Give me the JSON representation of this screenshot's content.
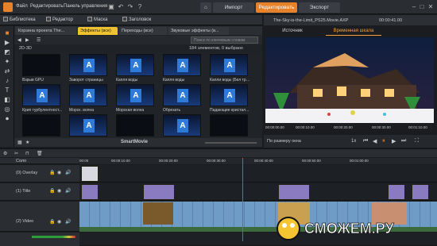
{
  "menu": {
    "items": [
      "Файл",
      "Редактировать",
      "Панель управления"
    ],
    "tabs": [
      "Импорт",
      "Редактировать",
      "Экспорт"
    ],
    "active_tab": "Редактировать"
  },
  "library_toolbar": {
    "library": "Библиотека",
    "editor": "Редактор",
    "mask": "Маска",
    "title": "Заголовок"
  },
  "project_title": "The-Sky-is-the-Limit_PS25.Movie.AXP",
  "timecode_top": "00:00:41.00",
  "lib_tabs": [
    "Корзина проекта The...",
    "Эффекты (все)",
    "Переходы (все)",
    "Звуковые эффекты (в..."
  ],
  "lib_active": "Эффекты (все)",
  "search_placeholder": "Поиск по ключевым словам",
  "category": "2D-3D",
  "count_text": "184 элементов, 0 выбрано",
  "grid": [
    {
      "label": "Взрыв GPU",
      "style": "dark"
    },
    {
      "label": "Заворот страницы",
      "style": "blue"
    },
    {
      "label": "Капля воды",
      "style": "blue"
    },
    {
      "label": "Капля воды",
      "style": "blue"
    },
    {
      "label": "Капли воды (Бел тра...",
      "style": "blue"
    },
    {
      "label": "Крип турбулентност...",
      "style": "blue"
    },
    {
      "label": "Морск. волна",
      "style": "blue"
    },
    {
      "label": "Морская волна",
      "style": "blue"
    },
    {
      "label": "Обрезать",
      "style": "blue"
    },
    {
      "label": "Падающие кристал...",
      "style": "blue"
    },
    {
      "label": "",
      "style": "dark"
    },
    {
      "label": "",
      "style": "blue"
    },
    {
      "label": "",
      "style": "dark"
    },
    {
      "label": "",
      "style": "blue"
    },
    {
      "label": "",
      "style": "dark"
    }
  ],
  "smartmovie": "SmartMovie",
  "preview": {
    "tabs": [
      "Источник",
      "Временная шкала"
    ],
    "active": "Временная шкала",
    "ruler_times": [
      "00:00:00.00",
      "00:00:10.00",
      "00:00:20.00",
      "00:00:30.00",
      "00:01:10.00"
    ],
    "zoom": "По размеру окна",
    "speed": "1x"
  },
  "tracks": [
    {
      "name": "Соло"
    },
    {
      "name": "(0) Overlay"
    },
    {
      "name": "(1) Title"
    },
    {
      "name": "(2) Video"
    }
  ],
  "timeline_ruler": [
    "00:00",
    "00:00:10.00",
    "00:00:20.00",
    "00:00:30.00",
    "00:00:40.00",
    "00:00:50.00",
    "00:01:00.00"
  ],
  "watermark": "СМОЖЕМ.РУ",
  "colors": {
    "accent": "#e7822b",
    "tab_active": "#f0c230"
  }
}
